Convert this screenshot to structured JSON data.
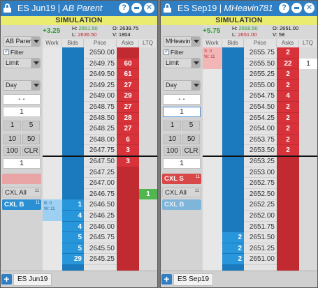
{
  "windows": [
    {
      "title_instrument": "ES Jun19",
      "title_account": "AB Parent",
      "mode": "SIMULATION",
      "pnl": "+3.25",
      "stats": {
        "h_label": "H:",
        "h": "2651.50",
        "l_label": "L:",
        "l": "2636.50",
        "o_label": "O:",
        "o": "2639.75",
        "v_label": "V:",
        "v": "1804"
      },
      "account_dropdown": "AB Parent",
      "filter_label": "Filter",
      "order_type": "Limit",
      "tif": "Day",
      "price_field": "- -",
      "qty_field": "1",
      "quick_qty": [
        "1",
        "5",
        "10",
        "50",
        "100",
        "CLR"
      ],
      "qty_display": "1",
      "cxl_sell": "",
      "cxl_sell_count": "",
      "cxl_all": "CXL All",
      "cxl_all_count": "11",
      "cxl_buy": "CXL B",
      "cxl_buy_count": "11",
      "headers": [
        "Work",
        "Bids",
        "Price",
        "Asks",
        "LTQ"
      ],
      "rows": [
        {
          "price": "2650.00",
          "ask": "",
          "bid": ""
        },
        {
          "price": "2649.75",
          "ask": "60",
          "bid": ""
        },
        {
          "price": "2649.50",
          "ask": "61",
          "bid": ""
        },
        {
          "price": "2649.25",
          "ask": "27",
          "bid": ""
        },
        {
          "price": "2649.00",
          "ask": "29",
          "bid": ""
        },
        {
          "price": "2648.75",
          "ask": "27",
          "bid": ""
        },
        {
          "price": "2648.50",
          "ask": "28",
          "bid": ""
        },
        {
          "price": "2648.25",
          "ask": "27",
          "bid": ""
        },
        {
          "price": "2648.00",
          "ask": "6",
          "bid": ""
        },
        {
          "price": "2647.75",
          "ask": "3",
          "bid": ""
        },
        {
          "price": "2647.50",
          "ask": "3",
          "bid": ""
        },
        {
          "price": "2647.25",
          "ask": "",
          "bid": ""
        },
        {
          "price": "2647.00",
          "ask": "",
          "bid": ""
        },
        {
          "price": "2646.75",
          "ask": "",
          "bid": "",
          "ltq": "1"
        },
        {
          "price": "2646.50",
          "ask": "",
          "bid": "1"
        },
        {
          "price": "2646.25",
          "ask": "",
          "bid": "4"
        },
        {
          "price": "2646.00",
          "ask": "",
          "bid": "4"
        },
        {
          "price": "2645.75",
          "ask": "",
          "bid": "5"
        },
        {
          "price": "2645.50",
          "ask": "",
          "bid": "5"
        },
        {
          "price": "2645.25",
          "ask": "",
          "bid": "29"
        }
      ],
      "work_order": {
        "b": "B: 0",
        "w": "W: 11"
      },
      "tab": "ES Jun19"
    },
    {
      "title_instrument": "ES Sep19",
      "title_account": "MHeavin781",
      "mode": "SIMULATION",
      "pnl": "+5.75",
      "stats": {
        "h_label": "H:",
        "h": "2658.50",
        "l_label": "L:",
        "l": "2651.00",
        "o_label": "O:",
        "o": "2651.00",
        "v_label": "V:",
        "v": "58"
      },
      "account_dropdown": "MHeavin781",
      "filter_label": "Filter",
      "order_type": "Limit",
      "tif": "Day",
      "price_field": "- -",
      "qty_field": "1",
      "quick_qty": [
        "1",
        "5",
        "10",
        "50",
        "100",
        "CLR"
      ],
      "qty_display": "1",
      "cxl_sell": "CXL S",
      "cxl_sell_count": "11",
      "cxl_all": "CXL All",
      "cxl_all_count": "11",
      "cxl_buy": "CXL B",
      "cxl_buy_count": "",
      "headers": [
        "Work",
        "Bids",
        "Price",
        "Asks",
        "LTQ"
      ],
      "rows": [
        {
          "price": "2655.75",
          "ask": "2",
          "bid": ""
        },
        {
          "price": "2655.50",
          "ask": "22",
          "bid": "",
          "ltq": "1"
        },
        {
          "price": "2655.25",
          "ask": "2",
          "bid": ""
        },
        {
          "price": "2655.00",
          "ask": "2",
          "bid": ""
        },
        {
          "price": "2654.75",
          "ask": "4",
          "bid": ""
        },
        {
          "price": "2654.50",
          "ask": "2",
          "bid": ""
        },
        {
          "price": "2654.25",
          "ask": "2",
          "bid": ""
        },
        {
          "price": "2654.00",
          "ask": "2",
          "bid": ""
        },
        {
          "price": "2653.75",
          "ask": "2",
          "bid": ""
        },
        {
          "price": "2653.50",
          "ask": "2",
          "bid": ""
        },
        {
          "price": "2653.25",
          "ask": "",
          "bid": ""
        },
        {
          "price": "2653.00",
          "ask": "",
          "bid": ""
        },
        {
          "price": "2652.75",
          "ask": "",
          "bid": ""
        },
        {
          "price": "2652.50",
          "ask": "",
          "bid": ""
        },
        {
          "price": "2652.25",
          "ask": "",
          "bid": ""
        },
        {
          "price": "2652.00",
          "ask": "",
          "bid": ""
        },
        {
          "price": "2651.75",
          "ask": "",
          "bid": ""
        },
        {
          "price": "2651.50",
          "ask": "",
          "bid": "2"
        },
        {
          "price": "2651.25",
          "ask": "",
          "bid": "2"
        },
        {
          "price": "2651.00",
          "ask": "",
          "bid": "2"
        }
      ],
      "work_order": {
        "s": "S: 0",
        "w": "W: 11"
      },
      "tab": "ES Sep19"
    }
  ],
  "colors": {
    "title_blue": "#2f7fc5",
    "sim_yellow": "#e9ec6e",
    "bid_blue": "#2896db",
    "ask_red": "#d8333b",
    "ltq_green": "#4fb74d"
  },
  "icons": [
    "lock-icon",
    "help-icon",
    "minimize-icon",
    "close-icon",
    "add-tab-icon",
    "hand-cursor-icon"
  ]
}
